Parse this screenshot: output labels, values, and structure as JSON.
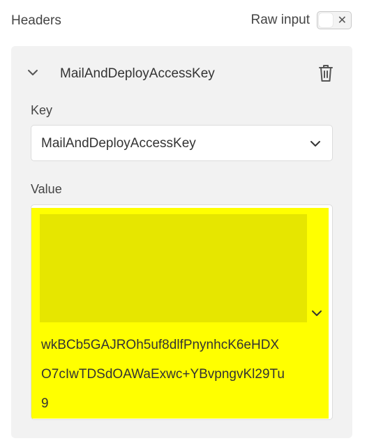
{
  "headers": {
    "title": "Headers",
    "raw_input_label": "Raw input",
    "raw_input_toggle": "off"
  },
  "entry": {
    "title": "MailAndDeployAccessKey",
    "key_label": "Key",
    "key_value": "MailAndDeployAccessKey",
    "value_label": "Value",
    "value_lines": [
      "wkBCb5GAJROh5uf8dlfPnynhcK6eHDX",
      "O7cIwTDSdOAWaExwc+YBvpngvKl29Tu",
      "9"
    ]
  },
  "colors": {
    "panel_background": "#f2f2f2",
    "highlight": "#ffff00",
    "redaction": "#e6e600"
  },
  "icons": {
    "collapse": "chevron-up-icon",
    "delete": "trash-icon",
    "dropdown": "chevron-down-icon",
    "toggle_off": "close-icon"
  }
}
